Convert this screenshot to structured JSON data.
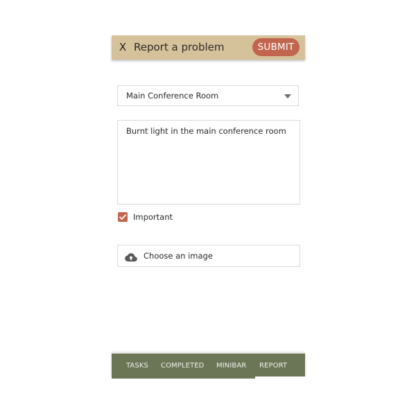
{
  "appbar": {
    "close_label": "X",
    "title": "Report a problem",
    "submit_label": "SUBMIT"
  },
  "form": {
    "location_select": {
      "value": "Main Conference Room"
    },
    "description": {
      "value": "Burnt light in the main conference room"
    },
    "important": {
      "label": "Important",
      "checked": true
    },
    "image_upload": {
      "label": "Choose an image",
      "icon": "cloud-upload-icon"
    }
  },
  "bottom_nav": {
    "tabs": [
      {
        "label": "TASKS"
      },
      {
        "label": "COMPLETED"
      },
      {
        "label": "MINIBAR"
      },
      {
        "label": "REPORT"
      }
    ],
    "active": "REPORT"
  },
  "colors": {
    "appbar": "#d6c29a",
    "accent": "#c2654f",
    "nav": "#6b7657"
  }
}
